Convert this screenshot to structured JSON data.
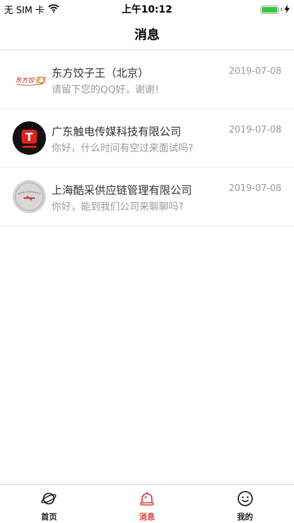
{
  "status_bar": {
    "carrier": "无 SIM 卡",
    "time": "上午10:12",
    "battery_level": 1.0
  },
  "nav": {
    "title": "消息"
  },
  "messages": [
    {
      "name": "东方饺子王（北京）",
      "date": "2019-07-08",
      "preview": "请留下您的QQ好，谢谢！",
      "avatar_text": "东方饺子王"
    },
    {
      "name": "广东触电传媒科技有限公司",
      "date": "2019-07-08",
      "preview": "你好，什么时间有空过来面试吗?",
      "avatar_text": "T"
    },
    {
      "name": "上海酷采供应链管理有限公司",
      "date": "2019-07-08",
      "preview": "你好，能到我们公司来聊聊吗?"
    }
  ],
  "tab_bar": {
    "active_color": "#e03b3b",
    "items": [
      {
        "label": "首页",
        "icon": "planet-icon"
      },
      {
        "label": "消息",
        "icon": "bell-icon"
      },
      {
        "label": "我的",
        "icon": "smiley-icon"
      }
    ]
  }
}
